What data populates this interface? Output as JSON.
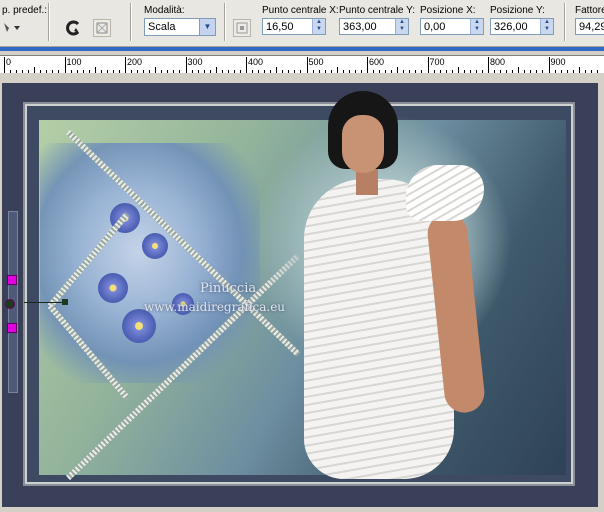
{
  "toolbar": {
    "preset_label": "p. predef.:",
    "mode_label": "Modalità:",
    "mode_value": "Scala",
    "center_x_label": "Punto centrale X:",
    "center_x_value": "16,50",
    "center_y_label": "Punto centrale Y:",
    "center_y_value": "363,00",
    "pos_x_label": "Posizione X:",
    "pos_x_value": "0,00",
    "pos_y_label": "Posizione Y:",
    "pos_y_value": "326,00",
    "factor_label": "Fattore",
    "factor_value": "94,29"
  },
  "ruler": {
    "marks": [
      "0",
      "100",
      "200",
      "300",
      "400",
      "500",
      "600",
      "700",
      "800",
      "900"
    ]
  },
  "artwork": {
    "watermark_name": "Pinuccia",
    "watermark_url": "www.maidiregrafica.eu"
  }
}
